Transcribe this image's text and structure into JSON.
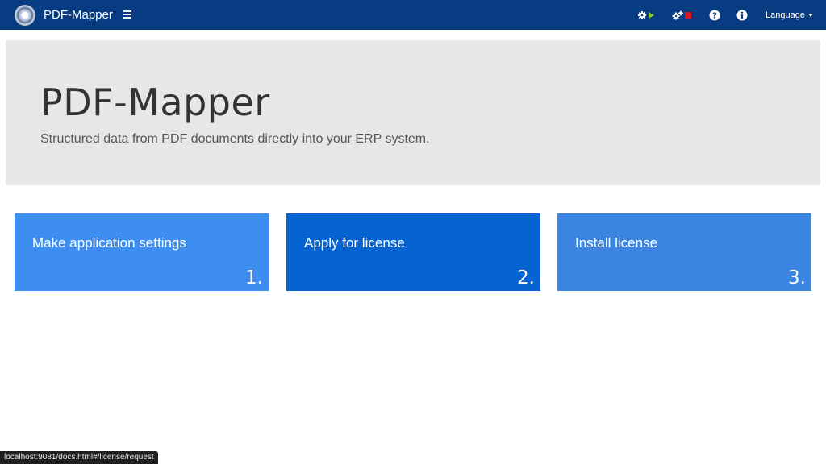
{
  "navbar": {
    "brand": "PDF-Mapper",
    "language_label": "Language"
  },
  "icons": {
    "service1": "gear-play-icon",
    "service2": "gears-stop-icon",
    "help": "question-circle-icon",
    "info": "info-circle-icon"
  },
  "colors": {
    "navbar": "#073c82",
    "play": "#8dc63f",
    "stop": "#e0141e",
    "tile1": "#3d8ef0",
    "tile2": "#0564d1",
    "tile3": "#3b84e0"
  },
  "jumbotron": {
    "title": "PDF-Mapper",
    "subtitle": "Structured data from PDF documents directly into your ERP system."
  },
  "tiles": [
    {
      "label": "Make application settings",
      "number": "1."
    },
    {
      "label": "Apply for license",
      "number": "2."
    },
    {
      "label": "Install license",
      "number": "3."
    }
  ],
  "statusbar": {
    "url": "localhost:9081/docs.html#/license/request"
  }
}
